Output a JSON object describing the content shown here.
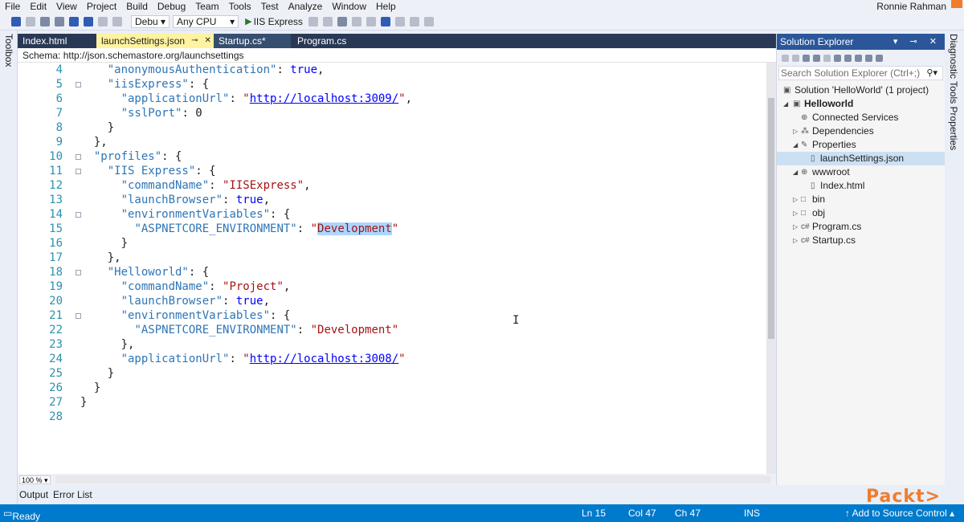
{
  "menu": {
    "items": [
      "File",
      "Edit",
      "View",
      "Project",
      "Build",
      "Debug",
      "Team",
      "Tools",
      "Test",
      "Analyze",
      "Window",
      "Help"
    ],
    "user": "Ronnie Rahman"
  },
  "toolbar": {
    "config": "Debu",
    "platform": "Any CPU",
    "run_target": "IIS Express"
  },
  "left_strip": {
    "label": "Toolbox"
  },
  "right_strip": {
    "label": "Diagnostic Tools  Properties"
  },
  "tabs": [
    {
      "label": "Index.html"
    },
    {
      "label": "launchSettings.json"
    },
    {
      "label": "Startup.cs*"
    },
    {
      "label": "Program.cs"
    }
  ],
  "schema": {
    "prefix": "Schema:",
    "url": "http://json.schemastore.org/launchsettings"
  },
  "editor": {
    "lines": [
      {
        "n": "4"
      },
      {
        "n": "5"
      },
      {
        "n": "6"
      },
      {
        "n": "7"
      },
      {
        "n": "8"
      },
      {
        "n": "9"
      },
      {
        "n": "10"
      },
      {
        "n": "11"
      },
      {
        "n": "12"
      },
      {
        "n": "13"
      },
      {
        "n": "14"
      },
      {
        "n": "15"
      },
      {
        "n": "16"
      },
      {
        "n": "17"
      },
      {
        "n": "18"
      },
      {
        "n": "19"
      },
      {
        "n": "20"
      },
      {
        "n": "21"
      },
      {
        "n": "22"
      },
      {
        "n": "23"
      },
      {
        "n": "24"
      },
      {
        "n": "25"
      },
      {
        "n": "26"
      },
      {
        "n": "27"
      },
      {
        "n": "28"
      }
    ],
    "t": {
      "anonAuth": "\"anonymousAuthentication\"",
      "true": "true",
      "iisExpress": "\"iisExpress\"",
      "applicationUrl": "\"applicationUrl\"",
      "url3009": "http://localhost:3009/",
      "sslPort": "\"sslPort\"",
      "zero": "0",
      "profiles": "\"profiles\"",
      "iisExpressProfile": "\"IIS Express\"",
      "commandName": "\"commandName\"",
      "cmdIIS": "\"IISExpress\"",
      "launchBrowser": "\"launchBrowser\"",
      "envVars": "\"environmentVariables\"",
      "aspnetEnv": "\"ASPNETCORE_ENVIRONMENT\"",
      "development": "Development",
      "developmentQuoted": "\"Development\"",
      "helloworld": "\"Helloworld\"",
      "cmdProject": "\"Project\"",
      "url3008": "http://localhost:3008/"
    }
  },
  "zoom": {
    "value": "100 %"
  },
  "output_tabs": [
    {
      "label": "Output"
    },
    {
      "label": "Error List"
    }
  ],
  "solution_explorer": {
    "title": "Solution Explorer",
    "search_placeholder": "Search Solution Explorer (Ctrl+;)",
    "tree": [
      {
        "label": "Solution 'HelloWorld' (1 project)"
      },
      {
        "label": "Helloworld"
      },
      {
        "label": "Connected Services"
      },
      {
        "label": "Dependencies"
      },
      {
        "label": "Properties"
      },
      {
        "label": "launchSettings.json"
      },
      {
        "label": "wwwroot"
      },
      {
        "label": "Index.html"
      },
      {
        "label": "bin"
      },
      {
        "label": "obj"
      },
      {
        "label": "Program.cs"
      },
      {
        "label": "Startup.cs"
      }
    ]
  },
  "status": {
    "ready": "Ready",
    "ln": "Ln 15",
    "col": "Col 47",
    "ch": "Ch 47",
    "ins": "INS",
    "source_control": "↑ Add to Source Control ▴"
  },
  "brand": {
    "logo_text": "Packt>"
  },
  "colors": {
    "tab_strip": "#293955",
    "active_tab": "#fff3a0",
    "status_bar": "#007acc",
    "se_title": "#2b579a",
    "line_numbers": "#2b91af",
    "string": "#a31515",
    "keyword": "#0000ff",
    "property": "#2e75b6",
    "selection": "#add6ff",
    "brand": "#f07c2c"
  }
}
